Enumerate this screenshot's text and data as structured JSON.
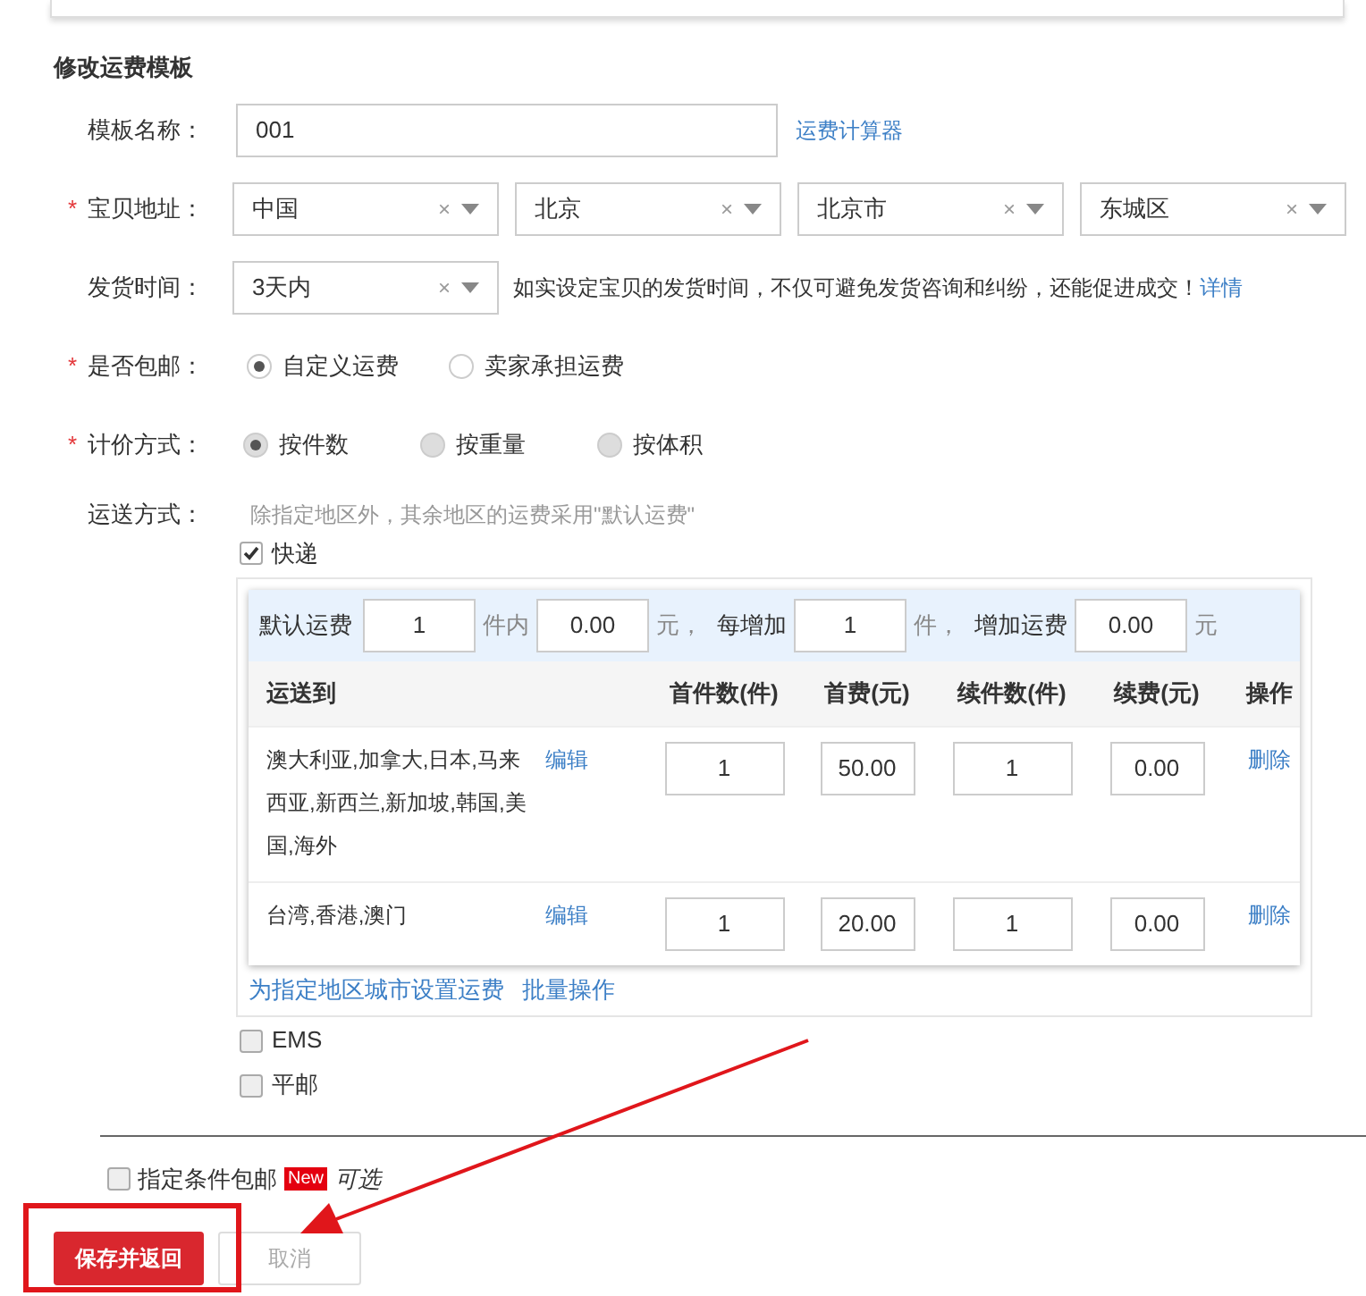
{
  "title": "修改运费模板",
  "template_name": {
    "label": "模板名称：",
    "value": "001",
    "link": "运费计算器"
  },
  "address": {
    "label": "宝贝地址：",
    "required_mark": "*",
    "selects": [
      {
        "value": "中国",
        "clear": "×"
      },
      {
        "value": "北京",
        "clear": "×"
      },
      {
        "value": "北京市",
        "clear": "×"
      },
      {
        "value": "东城区",
        "clear": "×"
      }
    ]
  },
  "ship_time": {
    "label": "发货时间：",
    "value": "3天内",
    "clear": "×",
    "hint": "如实设定宝贝的发货时间，不仅可避免发货咨询和纠纷，还能促进成交！",
    "link": "详情"
  },
  "free_shipping": {
    "label": "是否包邮：",
    "required_mark": "*",
    "options": [
      {
        "label": "自定义运费",
        "selected": true,
        "disabled": false
      },
      {
        "label": "卖家承担运费",
        "selected": false,
        "disabled": false
      }
    ]
  },
  "pricing": {
    "label": "计价方式：",
    "required_mark": "*",
    "options": [
      {
        "label": "按件数",
        "selected": true,
        "disabled": true
      },
      {
        "label": "按重量",
        "selected": false,
        "disabled": true
      },
      {
        "label": "按体积",
        "selected": false,
        "disabled": true
      }
    ]
  },
  "delivery": {
    "label": "运送方式：",
    "note": "除指定地区外，其余地区的运费采用\"默认运费\"",
    "methods": [
      {
        "label": "快递",
        "checked": true,
        "default_row": {
          "label": "默认运费",
          "first_qty": "1",
          "unit1": "件内",
          "first_fee": "0.00",
          "unit2": "元，",
          "each_label": "每增加",
          "add_qty": "1",
          "unit3": "件，",
          "add_label": "增加运费",
          "add_fee": "0.00",
          "unit4": "元"
        },
        "columns": [
          "运送到",
          "首件数(件)",
          "首费(元)",
          "续件数(件)",
          "续费(元)",
          "操作"
        ],
        "rows": [
          {
            "regions": "澳大利亚,加拿大,日本,马来西亚,新西兰,新加坡,韩国,美国,海外",
            "edit": "编辑",
            "first_qty": "1",
            "first_fee": "50.00",
            "add_qty": "1",
            "add_fee": "0.00",
            "delete": "删除"
          },
          {
            "regions": "台湾,香港,澳门",
            "edit": "编辑",
            "first_qty": "1",
            "first_fee": "20.00",
            "add_qty": "1",
            "add_fee": "0.00",
            "delete": "删除"
          }
        ],
        "links": [
          "为指定地区城市设置运费",
          "批量操作"
        ]
      },
      {
        "label": "EMS",
        "checked": false
      },
      {
        "label": "平邮",
        "checked": false
      }
    ]
  },
  "conditional": {
    "label": "指定条件包邮",
    "checked": false,
    "badge": "New",
    "optional": "可选"
  },
  "buttons": [
    {
      "label": "保存并返回",
      "kind": "primary"
    },
    {
      "label": "取消",
      "kind": "secondary"
    }
  ]
}
